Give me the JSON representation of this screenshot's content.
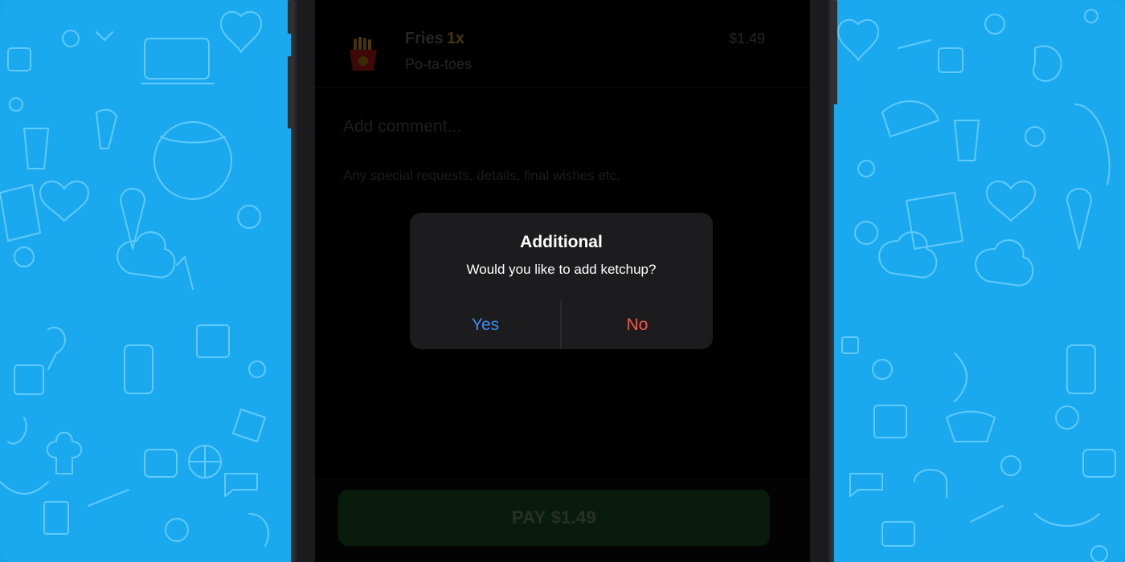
{
  "order": {
    "item": {
      "name": "Fries",
      "quantity": "1x",
      "description": "Po-ta-toes",
      "price": "$1.49",
      "icon": "fries-icon"
    },
    "comment": {
      "placeholder": "Add comment...",
      "hint": "Any special requests, details, final wishes etc."
    }
  },
  "alert": {
    "title": "Additional",
    "message": "Would you like to add ketchup?",
    "yes_label": "Yes",
    "no_label": "No"
  },
  "footer": {
    "pay_label": "PAY $1.49"
  },
  "colors": {
    "background_blue": "#1aa9ee",
    "yes_blue": "#3b8df0",
    "no_red": "#ec5b4d",
    "pay_green": "#0f2a14"
  }
}
